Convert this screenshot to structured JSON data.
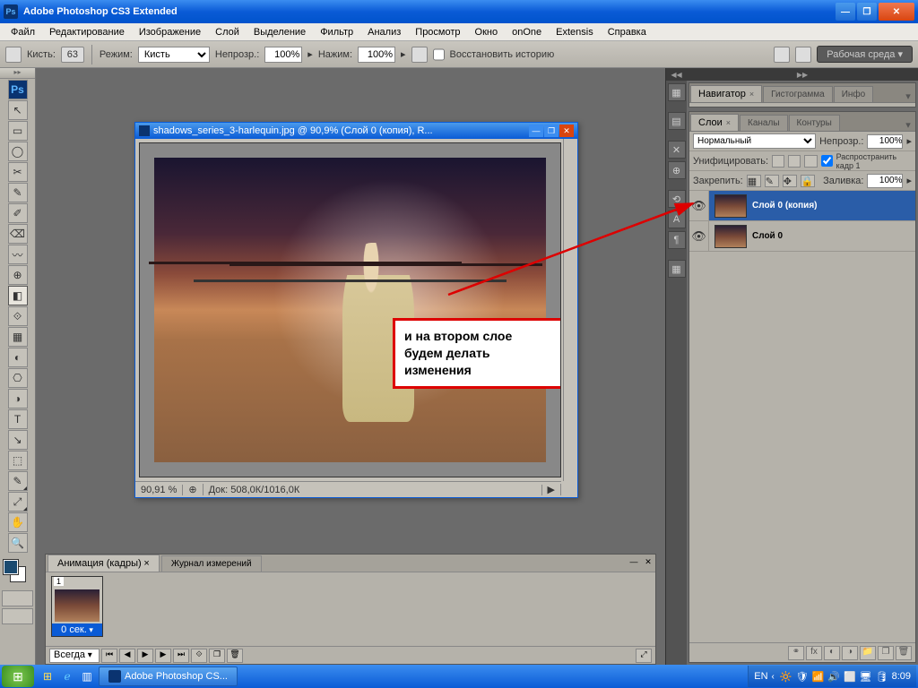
{
  "titlebar": {
    "app": "Adobe Photoshop CS3 Extended"
  },
  "menu": [
    "Файл",
    "Редактирование",
    "Изображение",
    "Слой",
    "Выделение",
    "Фильтр",
    "Анализ",
    "Просмотр",
    "Окно",
    "onOne",
    "Extensis",
    "Справка"
  ],
  "optbar": {
    "brush_label": "Кисть:",
    "brush_size": "63",
    "mode_label": "Режим:",
    "mode_value": "Кисть",
    "opacity_label": "Непрозр.:",
    "opacity_value": "100%",
    "flow_label": "Нажим:",
    "flow_value": "100%",
    "history_chk": "Восстановить историю",
    "workspace": "Рабочая среда"
  },
  "doc": {
    "title": "shadows_series_3-harlequin.jpg @ 90,9% (Слой 0 (копия), R...",
    "zoom": "90,91 %",
    "docsize": "Док: 508,0К/1016,0К"
  },
  "annotation": "и на втором слое будем делать изменения",
  "nav_tabs": [
    "Навигатор",
    "Гистограмма",
    "Инфо"
  ],
  "layer_tabs": [
    "Слои",
    "Каналы",
    "Контуры"
  ],
  "layer_panel": {
    "mode": "Нормальный",
    "opacity_label": "Непрозр.:",
    "opacity": "100%",
    "unify": "Унифицировать:",
    "propagate": "Распространить кадр 1",
    "lock": "Закрепить:",
    "fill_label": "Заливка:",
    "fill": "100%"
  },
  "layers": [
    {
      "name": "Слой 0 (копия)",
      "selected": true
    },
    {
      "name": "Слой 0",
      "selected": false
    }
  ],
  "anim": {
    "tab1": "Анимация (кадры)",
    "tab2": "Журнал измерений",
    "frame_num": "1",
    "frame_time": "0 сек.",
    "loop": "Всегда"
  },
  "taskbar": {
    "app": "Adobe Photoshop CS...",
    "lang": "EN",
    "time": "8:09"
  },
  "tools": [
    "↖",
    "▭",
    "◯",
    "✂",
    "✎",
    "✐",
    "⌫",
    "〰",
    "⊕",
    "◧",
    "⟐",
    "▦",
    "◐",
    "⎔",
    "◑",
    "⌀",
    "T",
    "↘",
    "⬚",
    "✋",
    "🔍"
  ]
}
